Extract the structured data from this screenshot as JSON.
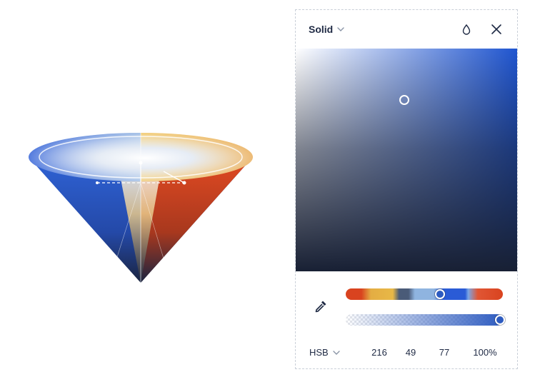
{
  "panel": {
    "fill_type": "Solid",
    "icons": {
      "fill_type_chevron": "chevron-down-icon",
      "blend": "drop-icon",
      "close": "close-icon",
      "eyedropper": "eyedropper-icon",
      "mode_chevron": "chevron-down-icon"
    }
  },
  "picker": {
    "hue_color": "#1f55d0",
    "selected_color": "#2d5bc0",
    "saturation_brightness_handle": {
      "saturation": 0.49,
      "brightness": 0.77
    },
    "hue_fraction": 0.6,
    "alpha_fraction": 1.0
  },
  "values": {
    "mode": "HSB",
    "h": "216",
    "s": "49",
    "b": "77",
    "alpha": "100%"
  }
}
